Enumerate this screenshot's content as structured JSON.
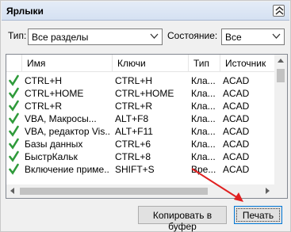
{
  "panel": {
    "title": "Ярлыки"
  },
  "filters": {
    "type_label": "Тип:",
    "type_value": "Все разделы",
    "status_label": "Состояние:",
    "status_value": "Все"
  },
  "list": {
    "columns": [
      "Имя",
      "Ключи",
      "Тип",
      "Источник"
    ],
    "rows": [
      {
        "name": "CTRL+H",
        "keys": "CTRL+H",
        "type": "Кла...",
        "source": "ACAD"
      },
      {
        "name": "CTRL+HOME",
        "keys": "CTRL+HOME",
        "type": "Кла...",
        "source": "ACAD"
      },
      {
        "name": "CTRL+R",
        "keys": "CTRL+R",
        "type": "Кла...",
        "source": "ACAD"
      },
      {
        "name": "VBA, Макросы...",
        "keys": "ALT+F8",
        "type": "Кла...",
        "source": "ACAD"
      },
      {
        "name": "VBA, редактор Vis...",
        "keys": "ALT+F11",
        "type": "Кла...",
        "source": "ACAD"
      },
      {
        "name": "Базы данных",
        "keys": "CTRL+6",
        "type": "Кла...",
        "source": "ACAD"
      },
      {
        "name": "БыстрКальк",
        "keys": "CTRL+8",
        "type": "Кла...",
        "source": "ACAD"
      },
      {
        "name": "Включение приме...",
        "keys": "SHIFT+S",
        "type": "Вре...",
        "source": "ACAD"
      }
    ]
  },
  "buttons": {
    "copy_label": "Копировать в буфер",
    "print_label": "Печать"
  },
  "colors": {
    "check": "#2e9a3a",
    "arrow": "#e02020",
    "focus": "#0078d7"
  }
}
